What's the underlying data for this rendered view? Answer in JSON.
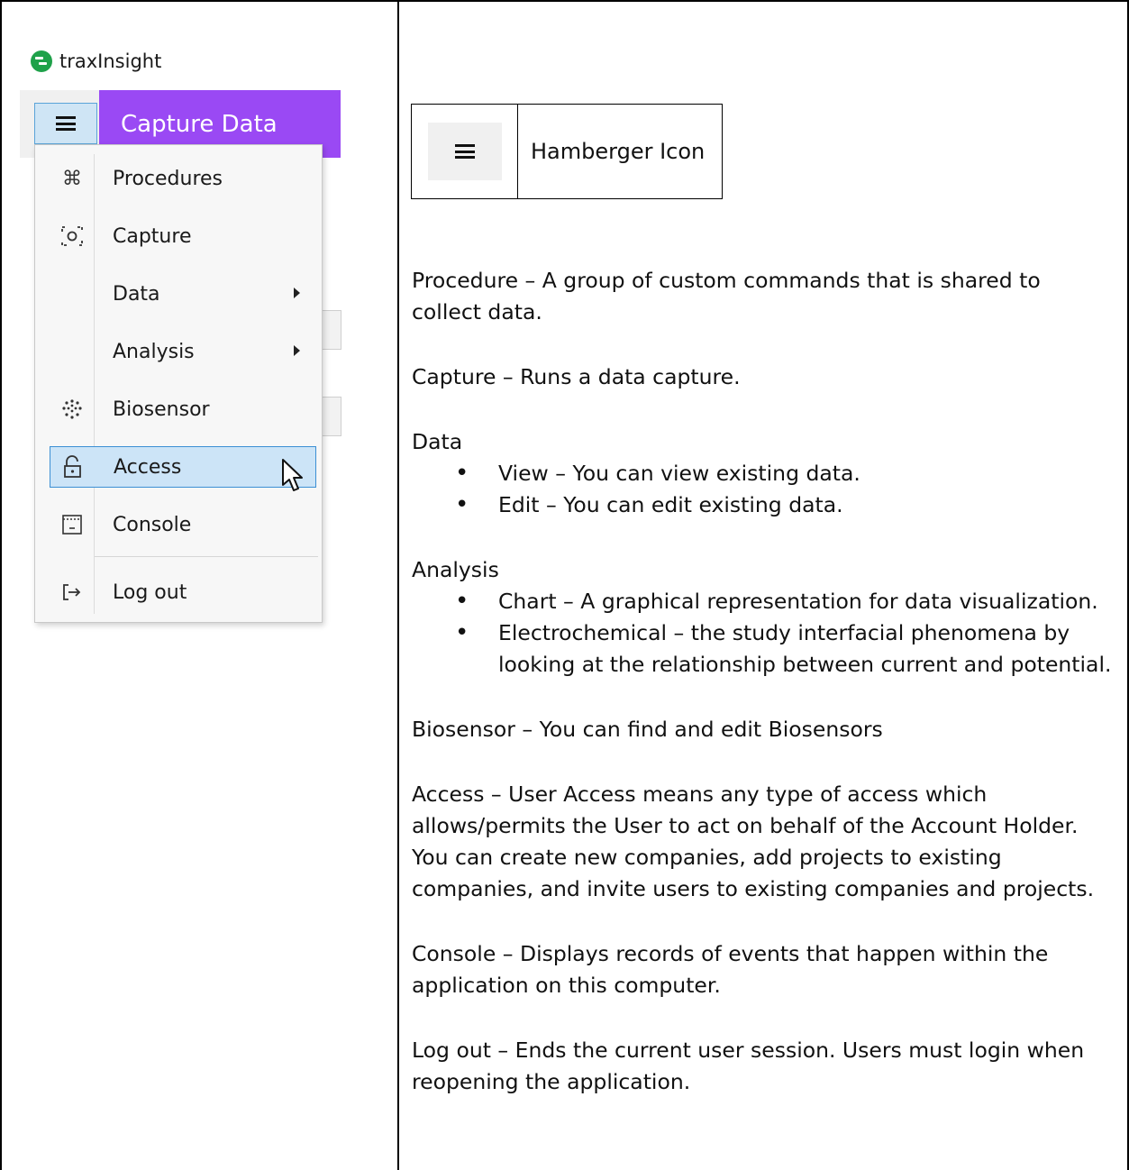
{
  "app": {
    "name": "traxInsight",
    "header_title": "Capture Data",
    "accent_color": "#9a49f4"
  },
  "menu": {
    "items": [
      {
        "label": "Procedures",
        "icon": "command-icon"
      },
      {
        "label": "Capture",
        "icon": "capture-icon"
      },
      {
        "label": "Data",
        "icon": "",
        "submenu": true
      },
      {
        "label": "Analysis",
        "icon": "",
        "submenu": true
      },
      {
        "label": "Biosensor",
        "icon": "biosensor-icon"
      },
      {
        "label": "Access",
        "icon": "unlock-icon",
        "selected": true
      },
      {
        "label": "Console",
        "icon": "console-icon"
      },
      {
        "label": "Log out",
        "icon": "logout-icon"
      }
    ]
  },
  "icon_table": {
    "label": "Hamberger Icon"
  },
  "descriptions": {
    "procedure": "Procedure – A group of custom commands that is shared to collect data.",
    "capture": "Capture – Runs a data capture.",
    "data_title": "Data",
    "data_items": [
      "View – You can view existing data.",
      "Edit – You can edit existing data."
    ],
    "analysis_title": "Analysis",
    "analysis_items": [
      "Chart – A graphical representation for data visualization.",
      "Electrochemical – the study interfacial phenomena by looking at the relationship between current and potential."
    ],
    "biosensor": "Biosensor – You can find and edit Biosensors",
    "access": "Access – User Access means any type of access which allows/permits the User to act on behalf of the Account Holder. You can create new companies, add projects to existing companies, and invite users to existing companies and projects.",
    "console": "Console – Displays records of events that happen within the application on this computer.",
    "logout": "Log out – Ends the current user session. Users must login when reopening the application."
  }
}
